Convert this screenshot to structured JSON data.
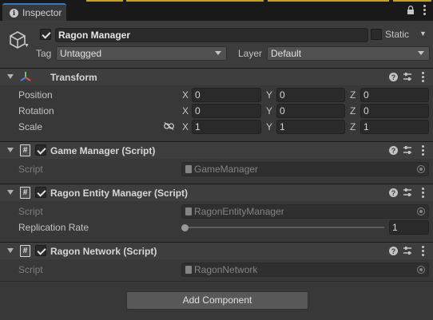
{
  "tab": {
    "title": "Inspector"
  },
  "game_object": {
    "name": "Ragon Manager",
    "active": true,
    "static_label": "Static",
    "tag_label": "Tag",
    "tag_value": "Untagged",
    "layer_label": "Layer",
    "layer_value": "Default"
  },
  "transform": {
    "title": "Transform",
    "position_label": "Position",
    "rotation_label": "Rotation",
    "scale_label": "Scale",
    "axis_x": "X",
    "axis_y": "Y",
    "axis_z": "Z",
    "position": {
      "x": "0",
      "y": "0",
      "z": "0"
    },
    "rotation": {
      "x": "0",
      "y": "0",
      "z": "0"
    },
    "scale": {
      "x": "1",
      "y": "1",
      "z": "1"
    }
  },
  "components": [
    {
      "title": "Game Manager (Script)",
      "enabled": true,
      "script_label": "Script",
      "script_value": "GameManager"
    },
    {
      "title": "Ragon Entity Manager (Script)",
      "enabled": true,
      "script_label": "Script",
      "script_value": "RagonEntityManager",
      "replication_label": "Replication Rate",
      "replication_value": "1",
      "replication_fraction": 0.0
    },
    {
      "title": "Ragon Network (Script)",
      "enabled": true,
      "script_label": "Script",
      "script_value": "RagonNetwork"
    }
  ],
  "add_component_label": "Add Component",
  "colors": {
    "accent_tab": "#3a79bb",
    "background": "#383838",
    "header": "#3e3e3e",
    "field": "#2a2a2a"
  },
  "icons": [
    "info-icon",
    "lock-icon",
    "kebab-menu-icon",
    "gameobject-cube-icon",
    "transform-axes-icon",
    "script-hash-icon",
    "help-icon",
    "preset-icon",
    "link-scale-icon",
    "object-picker-icon"
  ]
}
